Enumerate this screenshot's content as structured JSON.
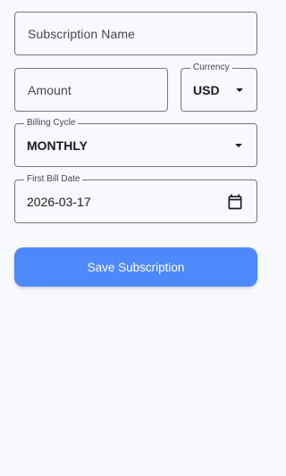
{
  "form": {
    "subscription_name": {
      "placeholder": "Subscription Name",
      "value": ""
    },
    "amount": {
      "placeholder": "Amount",
      "value": ""
    },
    "currency": {
      "label": "Currency",
      "value": "USD"
    },
    "billing_cycle": {
      "label": "Billing Cycle",
      "value": "MONTHLY"
    },
    "first_bill_date": {
      "label": "First Bill Date",
      "value": "2026-03-17"
    },
    "save_label": "Save Subscription"
  },
  "colors": {
    "background": "#f8f9fc",
    "outline": "#74777f",
    "primary_button": "#4d89fa",
    "button_text": "#ffffff"
  },
  "icons": {
    "dropdown": "caret-down-icon",
    "date": "calendar-icon"
  }
}
